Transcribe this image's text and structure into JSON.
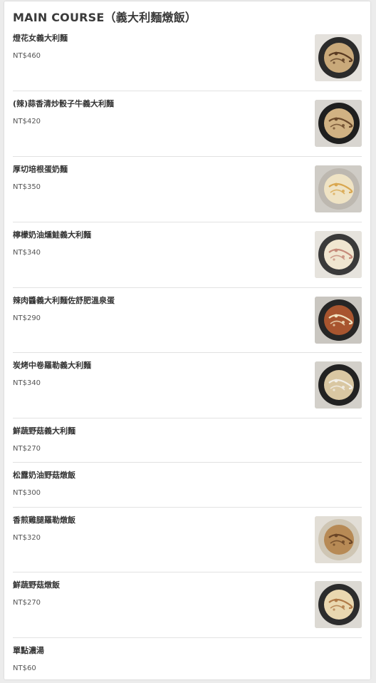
{
  "section": {
    "title": "MAIN COURSE（義大利麵燉飯）"
  },
  "items": [
    {
      "name": "燈花女義大利麵",
      "price": "NT$460",
      "image": "pasta-photo"
    },
    {
      "name": "(辣)蒜香清炒骰子牛義大利麵",
      "price": "NT$420",
      "image": "pasta-photo"
    },
    {
      "name": "厚切培根蛋奶麵",
      "price": "NT$350",
      "image": "pasta-photo"
    },
    {
      "name": "檸檬奶油燻鮭義大利麵",
      "price": "NT$340",
      "image": "pasta-photo"
    },
    {
      "name": "辣肉醬義大利麵佐舒肥溫泉蛋",
      "price": "NT$290",
      "image": "pasta-photo"
    },
    {
      "name": "炭烤中卷羅勒義大利麵",
      "price": "NT$340",
      "image": "pasta-photo"
    },
    {
      "name": "鮮蔬野菇義大利麵",
      "price": "NT$270",
      "image": null
    },
    {
      "name": "松露奶油野菇燉飯",
      "price": "NT$300",
      "image": null
    },
    {
      "name": "香煎雞腿羅勒燉飯",
      "price": "NT$320",
      "image": "risotto-photo"
    },
    {
      "name": "鮮蔬野菇燉飯",
      "price": "NT$270",
      "image": "risotto-photo"
    },
    {
      "name": "單點濃湯",
      "price": "NT$60",
      "image": null
    }
  ]
}
